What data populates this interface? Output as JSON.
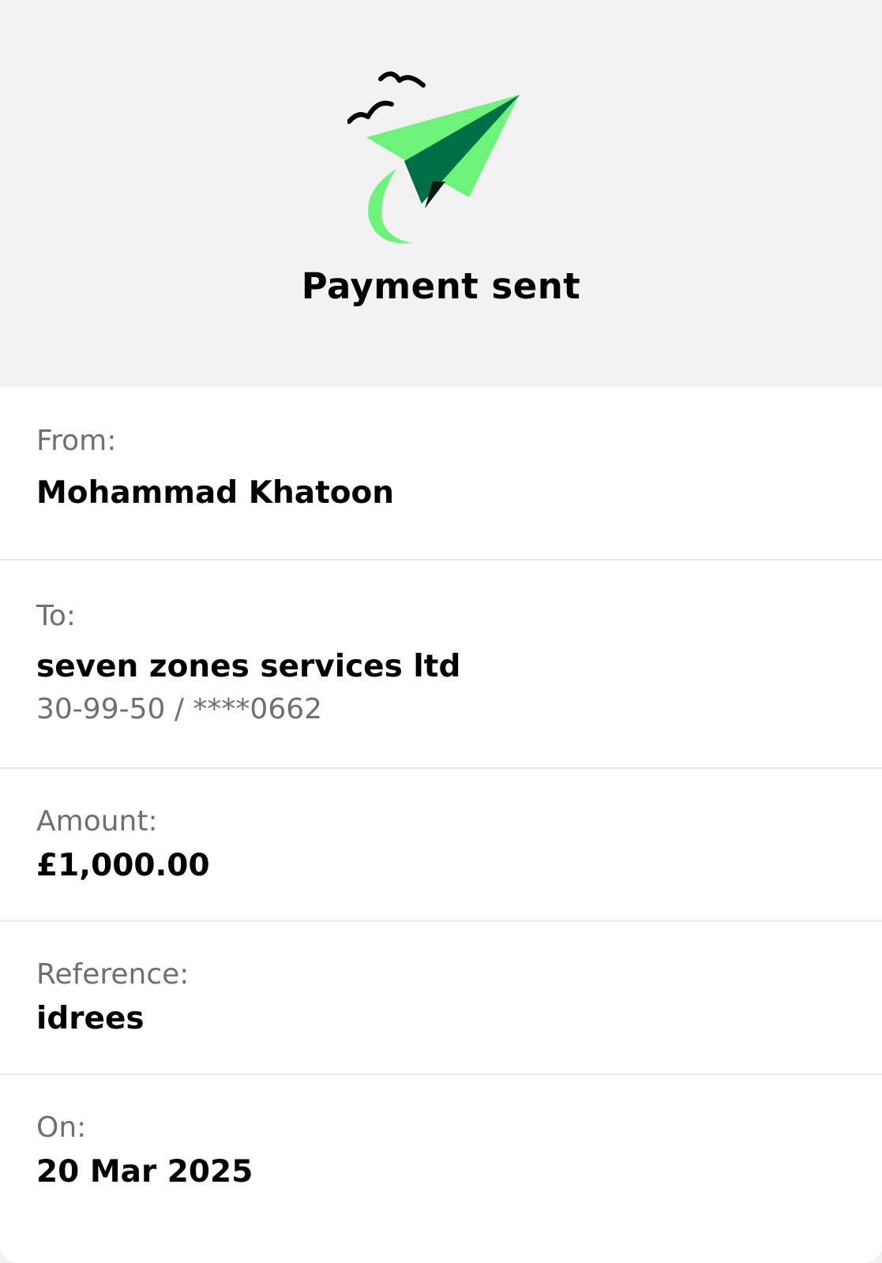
{
  "header": {
    "title": "Payment sent",
    "illustration_icon": "paper-plane-icon",
    "birds_icon": "birds-icon"
  },
  "colors": {
    "plane_light_green": "#6ef37a",
    "plane_dark_green": "#006e46",
    "plane_shadow": "#0b1a12",
    "header_background": "#f2f2f2",
    "label_gray": "#6f6f6f"
  },
  "details": {
    "from": {
      "label": "From:",
      "value": "Mohammad Khatoon"
    },
    "to": {
      "label": "To:",
      "value": "seven zones services ltd",
      "account": "30-99-50 / ****0662"
    },
    "amount": {
      "label": "Amount:",
      "value": "£1,000.00"
    },
    "reference": {
      "label": "Reference:",
      "value": "idrees"
    },
    "on": {
      "label": "On:",
      "value": "20 Mar 2025"
    }
  }
}
